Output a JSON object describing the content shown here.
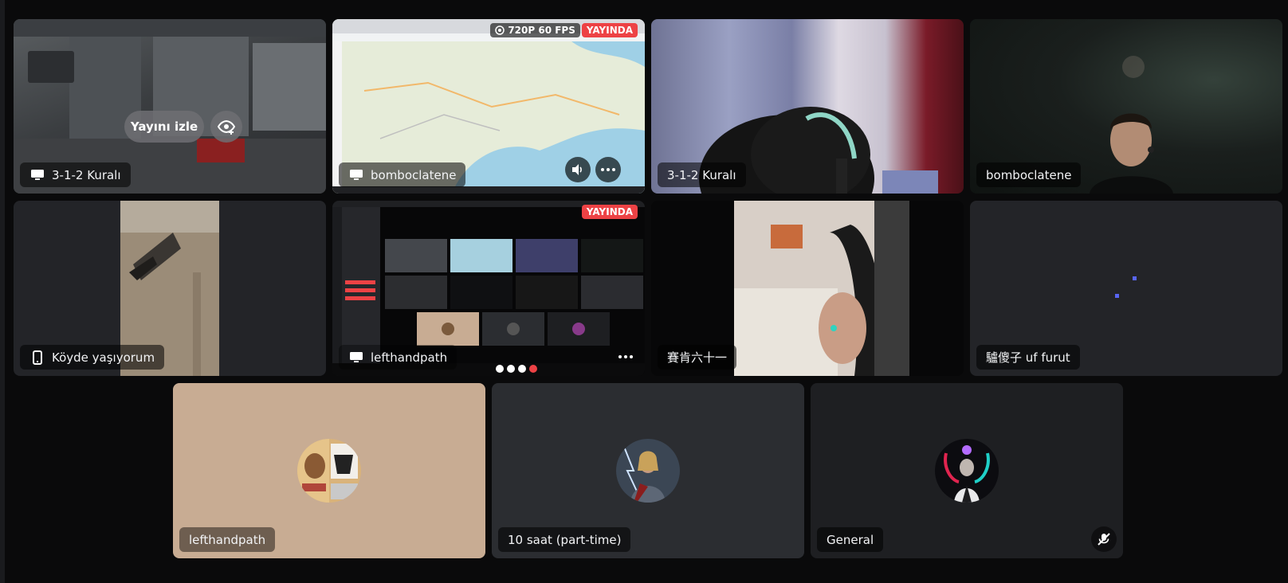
{
  "tiles": {
    "t1": {
      "label": "3-1-2 Kuralı",
      "watch_label": "Yayını izle",
      "kind": "stream"
    },
    "t2": {
      "label": "bomboclatene",
      "quality": "720P 60 FPS",
      "live": "YAYINDA",
      "kind": "stream"
    },
    "t3": {
      "label": "3-1-2 Kuralı",
      "kind": "camera"
    },
    "t4": {
      "label": "bomboclatene",
      "kind": "camera"
    },
    "t5": {
      "label": "Köyde yaşıyorum",
      "kind": "mobile-camera"
    },
    "t6": {
      "label": "lefthandpath",
      "live": "YAYINDA",
      "kind": "stream"
    },
    "t7": {
      "label": "賽肯六十一",
      "kind": "camera"
    },
    "t8": {
      "label": "驢傻子 uf furut",
      "kind": "screen"
    },
    "t9": {
      "label": "lefthandpath",
      "kind": "avatar"
    },
    "t10": {
      "label": "10 saat (part-time)",
      "kind": "avatar"
    },
    "t11": {
      "label": "General",
      "kind": "avatar",
      "muted": true
    }
  },
  "icons": {
    "screen": "monitor-icon",
    "mobile": "phone-icon",
    "eye": "eye-plus-icon",
    "volume": "volume-icon",
    "more": "more-icon",
    "mute": "mic-muted-icon"
  },
  "colors": {
    "live_red": "#ed4245",
    "background": "#0a0a0b",
    "tile_dark": "#232428"
  }
}
